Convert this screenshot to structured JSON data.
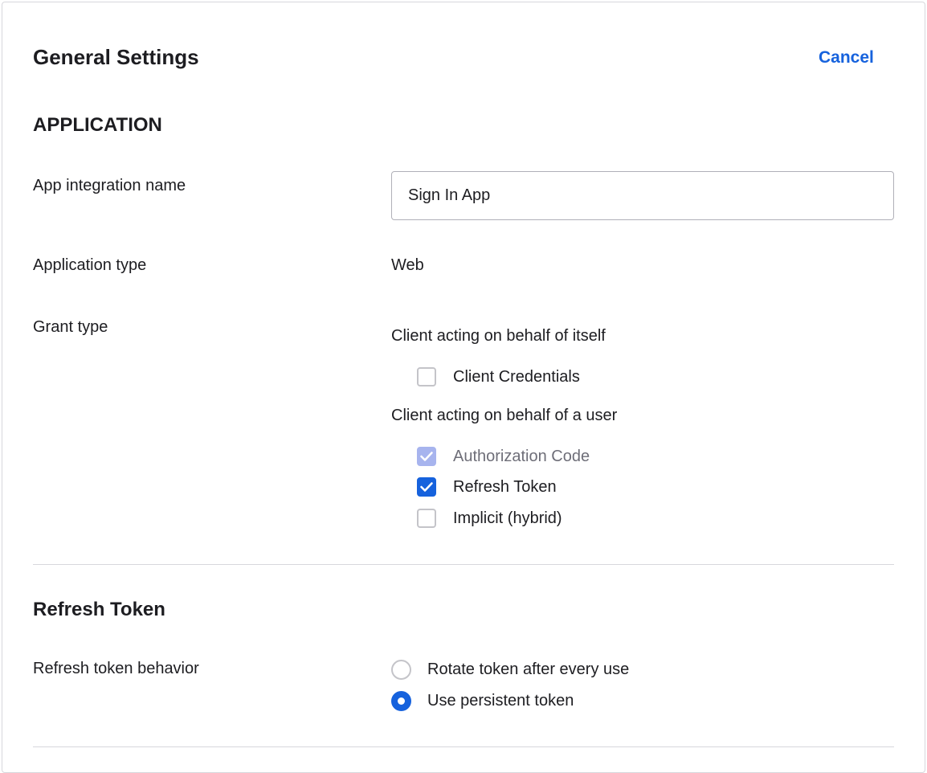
{
  "header": {
    "title": "General Settings",
    "cancel_label": "Cancel"
  },
  "application": {
    "heading": "APPLICATION",
    "integration_name_label": "App integration name",
    "integration_name_value": "Sign In App",
    "app_type_label": "Application type",
    "app_type_value": "Web",
    "grant_type_label": "Grant type",
    "grant_groups": [
      {
        "title": "Client acting on behalf of itself",
        "options": [
          {
            "label": "Client Credentials",
            "checked": false,
            "disabled": false
          }
        ]
      },
      {
        "title": "Client acting on behalf of a user",
        "options": [
          {
            "label": "Authorization Code",
            "checked": true,
            "disabled": true
          },
          {
            "label": "Refresh Token",
            "checked": true,
            "disabled": false
          },
          {
            "label": "Implicit (hybrid)",
            "checked": false,
            "disabled": false
          }
        ]
      }
    ]
  },
  "refresh_token": {
    "heading": "Refresh Token",
    "behavior_label": "Refresh token behavior",
    "options": [
      {
        "label": "Rotate token after every use",
        "selected": false
      },
      {
        "label": "Use persistent token",
        "selected": true
      }
    ]
  },
  "colors": {
    "accent": "#1662dd",
    "disabled_check": "#a7b4ee",
    "border": "#d7d7dc"
  }
}
